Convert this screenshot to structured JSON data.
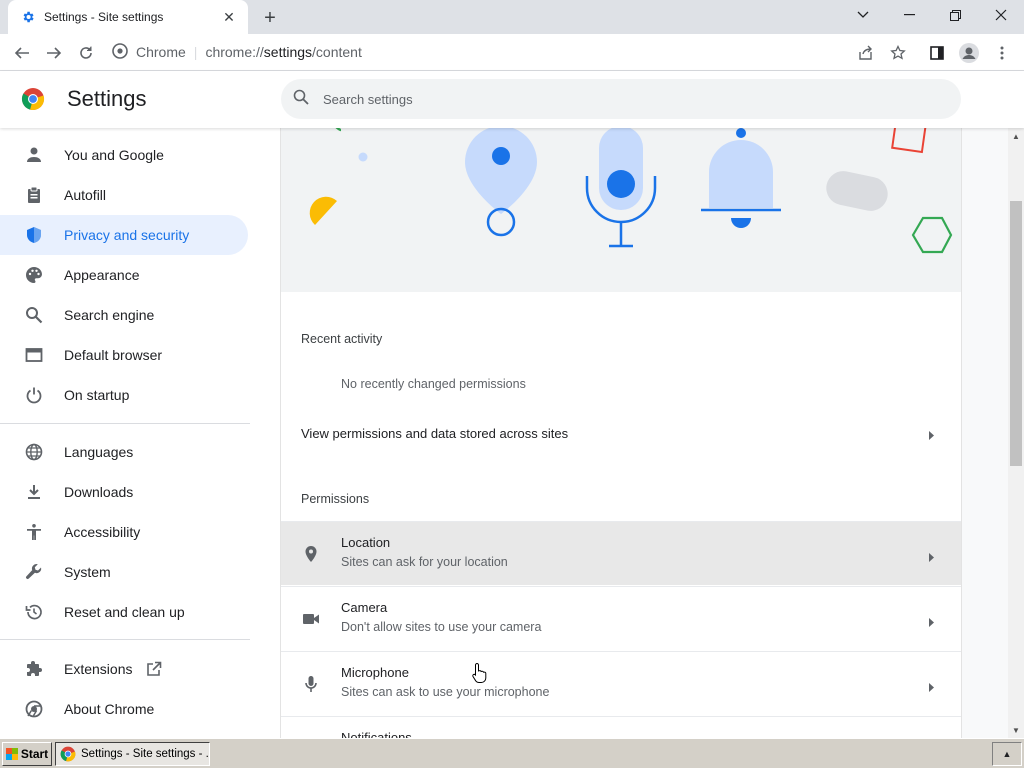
{
  "browser": {
    "tab": {
      "title": "Settings - Site settings",
      "icon": "gear-icon"
    },
    "window_controls": [
      "chevron-down-icon",
      "minimize-icon",
      "restore-icon",
      "close-icon"
    ],
    "omnibox": {
      "site_label": "Chrome",
      "url_prefix": "chrome://",
      "url_host": "settings",
      "url_path": "/content"
    }
  },
  "header": {
    "title": "Settings",
    "search_placeholder": "Search settings"
  },
  "sidebar": {
    "items": [
      {
        "label": "You and Google",
        "icon": "person-icon"
      },
      {
        "label": "Autofill",
        "icon": "clipboard-icon"
      },
      {
        "label": "Privacy and security",
        "icon": "shield-icon",
        "active": true
      },
      {
        "label": "Appearance",
        "icon": "palette-icon"
      },
      {
        "label": "Search engine",
        "icon": "search-icon"
      },
      {
        "label": "Default browser",
        "icon": "browser-icon"
      },
      {
        "label": "On startup",
        "icon": "power-icon"
      },
      {
        "label": "Languages",
        "icon": "globe-icon"
      },
      {
        "label": "Downloads",
        "icon": "download-icon"
      },
      {
        "label": "Accessibility",
        "icon": "accessibility-icon"
      },
      {
        "label": "System",
        "icon": "wrench-icon"
      },
      {
        "label": "Reset and clean up",
        "icon": "restore-history-icon"
      },
      {
        "label": "Extensions",
        "icon": "puzzle-icon"
      },
      {
        "label": "About Chrome",
        "icon": "chrome-icon"
      }
    ]
  },
  "main": {
    "recent_activity": {
      "heading": "Recent activity",
      "empty_text": "No recently changed permissions",
      "view_all_link": "View permissions and data stored across sites"
    },
    "permissions": {
      "heading": "Permissions",
      "items": [
        {
          "title": "Location",
          "subtitle": "Sites can ask for your location",
          "icon": "location-pin-icon"
        },
        {
          "title": "Camera",
          "subtitle": "Don't allow sites to use your camera",
          "icon": "camera-icon"
        },
        {
          "title": "Microphone",
          "subtitle": "Sites can ask to use your microphone",
          "icon": "microphone-icon"
        },
        {
          "title": "Notifications",
          "subtitle": "",
          "icon": "bell-icon"
        }
      ]
    }
  },
  "taskbar": {
    "start_label": "Start",
    "task_label": "Settings - Site settings - ..."
  },
  "colors": {
    "accent": "#1a73e8",
    "active_bg": "#e8f0fe",
    "hover_row": "#e8e8e8"
  }
}
